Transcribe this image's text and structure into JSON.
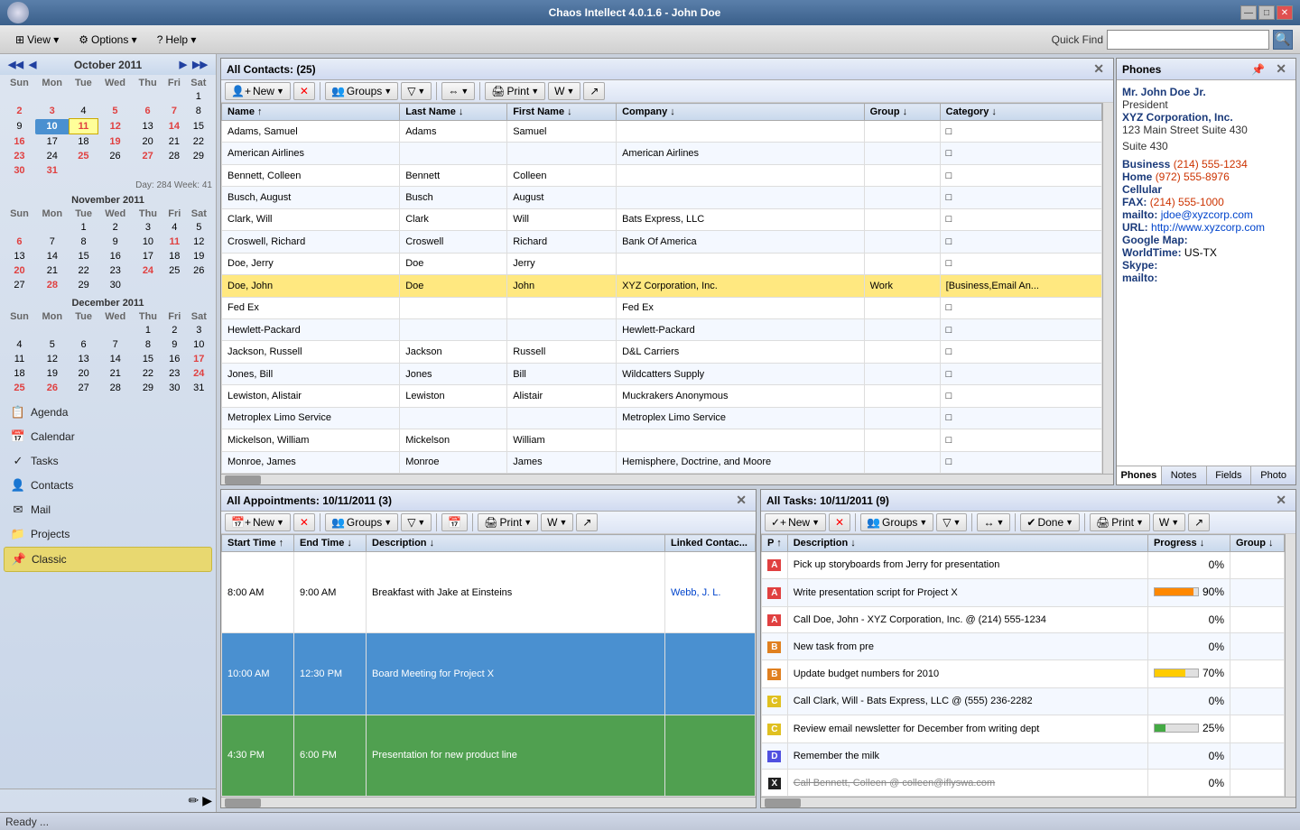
{
  "titlebar": {
    "title": "Chaos Intellect 4.0.1.6 - John Doe",
    "min_label": "—",
    "max_label": "□",
    "close_label": "✕"
  },
  "menubar": {
    "view_label": "View ▾",
    "options_label": "Options ▾",
    "help_label": "Help ▾",
    "quickfind_label": "Quick Find",
    "quickfind_placeholder": ""
  },
  "sidebar": {
    "months": [
      {
        "name": "October 2011",
        "days_header": [
          "Sun",
          "Mon",
          "Tue",
          "Wed",
          "Thu",
          "Fri",
          "Sat"
        ],
        "weeks": [
          [
            "",
            "",
            "",
            "",
            "",
            "",
            "1"
          ],
          [
            "2",
            "3",
            "4",
            "5",
            "6",
            "7",
            "8"
          ],
          [
            "9",
            "10",
            "11",
            "12",
            "13",
            "14",
            "15"
          ],
          [
            "16",
            "17",
            "18",
            "19",
            "20",
            "21",
            "22"
          ],
          [
            "23",
            "24",
            "25",
            "26",
            "27",
            "28",
            "29"
          ],
          [
            "30",
            "31",
            "",
            "",
            "",
            "",
            ""
          ]
        ]
      },
      {
        "name": "November 2011",
        "days_header": [
          "Sun",
          "Mon",
          "Tue",
          "Wed",
          "Thu",
          "Fri",
          "Sat"
        ],
        "weeks": [
          [
            "",
            "",
            "1",
            "2",
            "3",
            "4",
            "5"
          ],
          [
            "6",
            "7",
            "8",
            "9",
            "10",
            "11",
            "12"
          ],
          [
            "13",
            "14",
            "15",
            "16",
            "17",
            "18",
            "19"
          ],
          [
            "20",
            "21",
            "22",
            "23",
            "24",
            "25",
            "26"
          ],
          [
            "27",
            "28",
            "29",
            "30",
            "",
            "",
            ""
          ]
        ]
      },
      {
        "name": "December 2011",
        "days_header": [
          "Sun",
          "Mon",
          "Tue",
          "Wed",
          "Thu",
          "Fri",
          "Sat"
        ],
        "weeks": [
          [
            "",
            "",
            "",
            "",
            "1",
            "2",
            "3"
          ],
          [
            "4",
            "5",
            "6",
            "7",
            "8",
            "9",
            "10"
          ],
          [
            "11",
            "12",
            "13",
            "14",
            "15",
            "16",
            "17"
          ],
          [
            "18",
            "19",
            "20",
            "21",
            "22",
            "23",
            "24"
          ],
          [
            "25",
            "26",
            "27",
            "28",
            "29",
            "30",
            "31"
          ]
        ]
      }
    ],
    "week_info": "Day: 284  Week: 41",
    "nav_items": [
      {
        "id": "agenda",
        "label": "Agenda",
        "icon": "📋"
      },
      {
        "id": "calendar",
        "label": "Calendar",
        "icon": "📅"
      },
      {
        "id": "tasks",
        "label": "Tasks",
        "icon": "✓"
      },
      {
        "id": "contacts",
        "label": "Contacts",
        "icon": "👤"
      },
      {
        "id": "mail",
        "label": "Mail",
        "icon": "✉"
      },
      {
        "id": "projects",
        "label": "Projects",
        "icon": "📁"
      },
      {
        "id": "classic",
        "label": "Classic",
        "icon": "📌",
        "active": true
      }
    ]
  },
  "contacts": {
    "panel_title": "All Contacts:  (25)",
    "toolbar": {
      "new_label": "New",
      "delete_icon": "✕",
      "groups_label": "Groups",
      "filter_icon": "▼",
      "merge_icon": "⇔",
      "print_label": "Print",
      "word_icon": "W",
      "export_icon": "↗"
    },
    "columns": [
      "Name ↑",
      "Last Name ↓",
      "First Name ↓",
      "Company ↓",
      "Group ↓",
      "Category ↓"
    ],
    "rows": [
      {
        "name": "Adams, Samuel",
        "last": "Adams",
        "first": "Samuel",
        "company": "",
        "group": "",
        "category": ""
      },
      {
        "name": "American Airlines",
        "last": "",
        "first": "",
        "company": "American Airlines",
        "group": "",
        "category": ""
      },
      {
        "name": "Bennett, Colleen",
        "last": "Bennett",
        "first": "Colleen",
        "company": "",
        "group": "",
        "category": ""
      },
      {
        "name": "Busch, August",
        "last": "Busch",
        "first": "August",
        "company": "",
        "group": "",
        "category": ""
      },
      {
        "name": "Clark, Will",
        "last": "Clark",
        "first": "Will",
        "company": "Bats Express, LLC",
        "group": "",
        "category": ""
      },
      {
        "name": "Croswell, Richard",
        "last": "Croswell",
        "first": "Richard",
        "company": "Bank Of America",
        "group": "",
        "category": ""
      },
      {
        "name": "Doe, Jerry",
        "last": "Doe",
        "first": "Jerry",
        "company": "",
        "group": "",
        "category": ""
      },
      {
        "name": "Doe, John",
        "last": "Doe",
        "first": "John",
        "company": "XYZ Corporation, Inc.",
        "group": "Work",
        "category": "[Business,Email An...",
        "selected": true
      },
      {
        "name": "Fed Ex",
        "last": "",
        "first": "",
        "company": "Fed Ex",
        "group": "",
        "category": ""
      },
      {
        "name": "Hewlett-Packard",
        "last": "",
        "first": "",
        "company": "Hewlett-Packard",
        "group": "",
        "category": ""
      },
      {
        "name": "Jackson, Russell",
        "last": "Jackson",
        "first": "Russell",
        "company": "D&L Carriers",
        "group": "",
        "category": ""
      },
      {
        "name": "Jones, Bill",
        "last": "Jones",
        "first": "Bill",
        "company": "Wildcatters Supply",
        "group": "",
        "category": ""
      },
      {
        "name": "Lewiston, Alistair",
        "last": "Lewiston",
        "first": "Alistair",
        "company": "Muckrakers Anonymous",
        "group": "",
        "category": ""
      },
      {
        "name": "Metroplex Limo Service",
        "last": "",
        "first": "",
        "company": "Metroplex Limo Service",
        "group": "",
        "category": ""
      },
      {
        "name": "Mickelson, William",
        "last": "Mickelson",
        "first": "William",
        "company": "",
        "group": "",
        "category": ""
      },
      {
        "name": "Monroe, James",
        "last": "Monroe",
        "first": "James",
        "company": "Hemisphere, Doctrine, and Moore",
        "group": "",
        "category": ""
      }
    ]
  },
  "phones": {
    "panel_title": "Phones",
    "name": "Mr. John Doe Jr.",
    "title": "President",
    "company": "XYZ Corporation, Inc.",
    "address1": "123 Main Street Suite 430",
    "address2": "Suite 430",
    "business_label": "Business",
    "business_phone": "(214) 555-1234",
    "home_label": "Home",
    "home_phone": "(972) 555-8976",
    "cellular_label": "Cellular",
    "fax_label": "FAX:",
    "fax_phone": "(214) 555-1000",
    "email_label": "mailto:",
    "email": "jdoe@xyzcorp.com",
    "url_label": "URL:",
    "url": "http://www.xyzcorp.com",
    "google_map_label": "Google Map:",
    "worldtime_label": "WorldTime:",
    "worldtime": "US-TX",
    "skype_label": "Skype:",
    "skype_mailto_label": "mailto:",
    "tabs": [
      "Phones",
      "Notes",
      "Fields",
      "Photo"
    ]
  },
  "appointments": {
    "panel_title": "All Appointments: 10/11/2011  (3)",
    "toolbar": {
      "new_label": "New",
      "groups_label": "Groups",
      "print_label": "Print"
    },
    "columns": [
      "Start Time ↑",
      "End Time ↓",
      "Description ↓",
      "Linked Contac..."
    ],
    "rows": [
      {
        "start": "8:00 AM",
        "end": "9:00 AM",
        "description": "Breakfast with Jake at Einsteins",
        "contact": "Webb, J. L.",
        "color": "white"
      },
      {
        "start": "10:00 AM",
        "end": "12:30 PM",
        "description": "Board Meeting for Project X",
        "contact": "",
        "color": "blue"
      },
      {
        "start": "4:30 PM",
        "end": "6:00 PM",
        "description": "Presentation for new product line",
        "contact": "",
        "color": "green"
      }
    ]
  },
  "tasks": {
    "panel_title": "All Tasks: 10/11/2011  (9)",
    "toolbar": {
      "new_label": "New",
      "done_label": "Done",
      "print_label": "Print"
    },
    "columns": [
      "P ↑",
      "Description ↓",
      "Progress ↓",
      "Group ↓"
    ],
    "rows": [
      {
        "priority": "A",
        "description": "Pick up storyboards from Jerry for presentation",
        "progress": 0,
        "progress_color": "none"
      },
      {
        "priority": "A",
        "description": "Write presentation script for Project X",
        "progress": 90,
        "progress_color": "orange"
      },
      {
        "priority": "A",
        "description": "Call Doe, John - XYZ Corporation, Inc. @ (214) 555-1234",
        "progress": 0,
        "progress_color": "none"
      },
      {
        "priority": "B",
        "description": "New task from pre",
        "progress": 0,
        "progress_color": "none"
      },
      {
        "priority": "B",
        "description": "Update budget numbers for 2010",
        "progress": 70,
        "progress_color": "yellow"
      },
      {
        "priority": "C",
        "description": "Call Clark, Will - Bats Express, LLC @ (555) 236-2282",
        "progress": 0,
        "progress_color": "none"
      },
      {
        "priority": "C",
        "description": "Review email newsletter for December from writing dept",
        "progress": 25,
        "progress_color": "green"
      },
      {
        "priority": "D",
        "description": "Remember the milk",
        "progress": 0,
        "progress_color": "none"
      },
      {
        "priority": "X",
        "description": "Call Bennett, Colleen @ colleen@iflyswa.com",
        "progress": 0,
        "progress_color": "none",
        "strikethrough": true
      }
    ]
  },
  "statusbar": {
    "ready_label": "Ready ..."
  }
}
